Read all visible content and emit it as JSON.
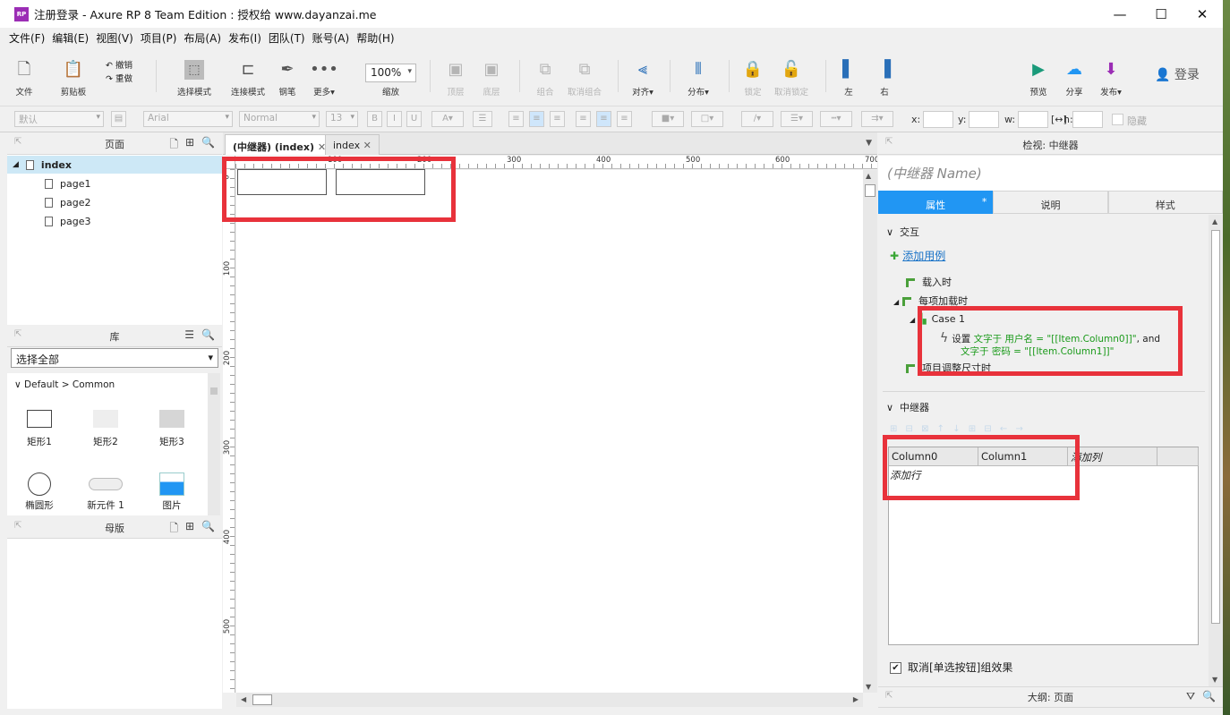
{
  "window": {
    "title": "注册登录 - Axure RP 8 Team Edition : 授权给 www.dayanzai.me",
    "app_icon": "RP",
    "controls": [
      "—",
      "☐",
      "✕"
    ]
  },
  "menu": [
    "文件(F)",
    "编辑(E)",
    "视图(V)",
    "项目(P)",
    "布局(A)",
    "发布(I)",
    "团队(T)",
    "账号(A)",
    "帮助(H)"
  ],
  "toolbar": {
    "file": "文件",
    "clipboard": "剪贴板",
    "undo": "撤销",
    "redo": "重做",
    "select_mode": "选择模式",
    "connect_mode": "连接模式",
    "pen": "钢笔",
    "more": "更多▾",
    "zoom_value": "100%",
    "zoom_label": "缩放",
    "top": "顶层",
    "bottom": "底层",
    "group": "组合",
    "ungroup": "取消组合",
    "align": "对齐▾",
    "distribute": "分布▾",
    "lock": "锁定",
    "unlock": "取消锁定",
    "left": "左",
    "right": "右",
    "preview": "预览",
    "share": "分享",
    "publish": "发布▾",
    "login": "登录"
  },
  "format_bar": {
    "style": "默认",
    "font": "Arial",
    "weight": "Normal",
    "size": "13",
    "x_label": "x:",
    "y_label": "y:",
    "w_label": "w:",
    "h_label": "h:",
    "hide_label": "隐藏"
  },
  "pages_panel": {
    "title": "页面",
    "items": [
      "index",
      "page1",
      "page2",
      "page3"
    ]
  },
  "library_panel": {
    "title": "库",
    "select": "选择全部",
    "category": "Default > Common",
    "widgets": [
      "矩形1",
      "矩形2",
      "矩形3",
      "椭圆形",
      "新元件 1",
      "图片"
    ]
  },
  "masters_panel": {
    "title": "母版"
  },
  "canvas": {
    "tabs": [
      "(中继器) (index)",
      "index"
    ],
    "ruler_h": [
      "100",
      "200",
      "300",
      "400",
      "500",
      "600",
      "700"
    ],
    "ruler_v": [
      "0",
      "100",
      "200",
      "300",
      "400",
      "500"
    ]
  },
  "inspector": {
    "title": "检视: 中继器",
    "name_placeholder": "(中继器 Name)",
    "tabs": [
      "属性",
      "说明",
      "样式"
    ],
    "tab_marker": "*",
    "interaction_title": "交互",
    "add_case": "添加用例",
    "events": [
      "载入时",
      "每项加载时",
      "项目调整尺寸时"
    ],
    "case_name": "Case 1",
    "action_verb": "设置",
    "action_line1": "文字于 用户名 = \"[[Item.Column0]]\"",
    "action_and": ", and",
    "action_line2": "文字于 密码 = \"[[Item.Column1]]\"",
    "repeater_title": "中继器",
    "columns": [
      "Column0",
      "Column1"
    ],
    "add_column": "添加列",
    "add_row": "添加行",
    "checkbox_label": "取消[单选按钮]组效果",
    "outline_label": "大纲: 页面"
  },
  "colors": {
    "highlight": "#e8323b",
    "active_tab": "#2196f3",
    "action_green": "#1a9a1a"
  }
}
